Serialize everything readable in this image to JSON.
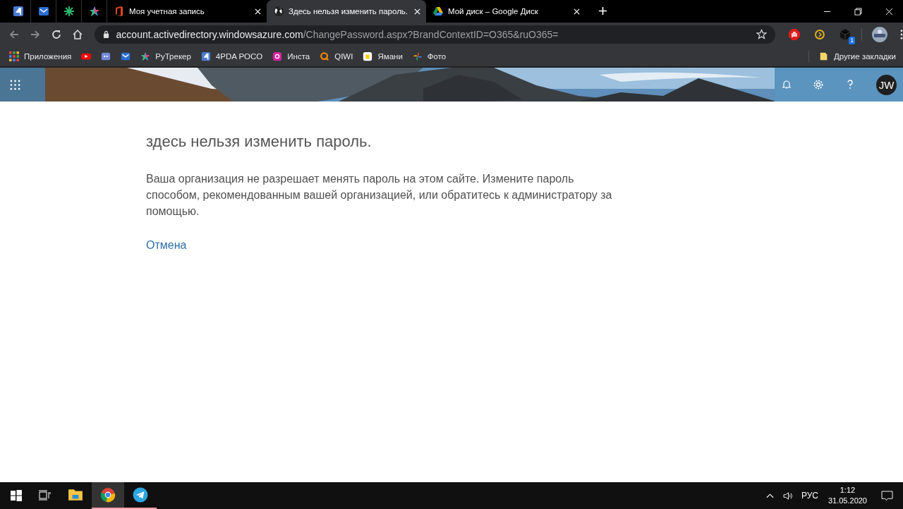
{
  "browser": {
    "tabs": [
      {
        "kind": "four",
        "selected": false
      },
      {
        "kind": "mail",
        "selected": false
      },
      {
        "kind": "green-star",
        "selected": false
      },
      {
        "kind": "color-star",
        "selected": false
      },
      {
        "kind": "office",
        "title": "Моя учетная запись",
        "selected": false
      },
      {
        "kind": "globe",
        "title": "Здесь нельзя изменить пароль.",
        "selected": true
      },
      {
        "kind": "drive",
        "title": "Мой диск – Google Диск",
        "selected": false
      }
    ],
    "address": {
      "host": "account.activedirectory.windowsazure.com",
      "path": "/ChangePassword.aspx?BrandContextID=O365&ruO365="
    },
    "extension_badge": "1",
    "bookmarks": [
      {
        "kind": "apps",
        "label": "Приложения"
      },
      {
        "kind": "youtube"
      },
      {
        "kind": "discord"
      },
      {
        "kind": "mail"
      },
      {
        "kind": "color-star",
        "label": "РуТрекер"
      },
      {
        "kind": "four",
        "label": "4PDA POCO"
      },
      {
        "kind": "insta",
        "label": "Инста"
      },
      {
        "kind": "qiwi",
        "label": "QIWI"
      },
      {
        "kind": "yamani",
        "label": "Ямани"
      },
      {
        "kind": "photos",
        "label": "Фото"
      }
    ],
    "other_bookmarks": "Другие закладки"
  },
  "header": {
    "avatar": "JW"
  },
  "content": {
    "title": "здесь нельзя изменить пароль.",
    "message": "Ваша организация не разрешает менять пароль на этом сайте. Измените пароль способом, рекомендованным вашей организацией, или обратитесь к администратору за помощью.",
    "cancel_link": "Отмена"
  },
  "taskbar": {
    "apps": [
      {
        "kind": "explorer",
        "running": false,
        "selected": false
      },
      {
        "kind": "chrome",
        "running": true,
        "selected": true
      },
      {
        "kind": "telegram",
        "running": true,
        "selected": false
      }
    ],
    "language": "РУС",
    "time": "1:12",
    "date": "31.05.2020"
  }
}
